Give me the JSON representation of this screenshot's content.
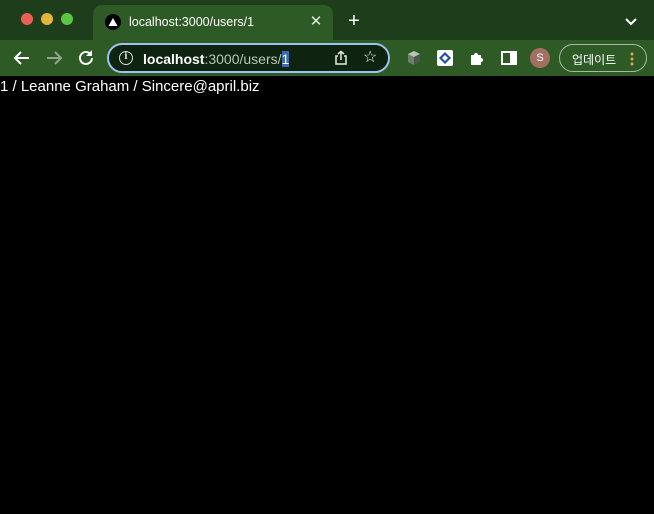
{
  "browser": {
    "tab": {
      "title": "localhost:3000/users/1",
      "favicon": "triangle-logo-icon"
    },
    "address_bar": {
      "host": "localhost",
      "path": ":3000/users/",
      "selected": "1"
    },
    "update_button": {
      "label": "업데이트"
    },
    "avatar_initial": "S",
    "colors": {
      "titlebar": "#1e3d1a",
      "toolbar": "#2e5a25",
      "focus_ring": "#9dc3f2"
    }
  },
  "page": {
    "content_text": "1 / Leanne Graham / Sincere@april.biz"
  }
}
